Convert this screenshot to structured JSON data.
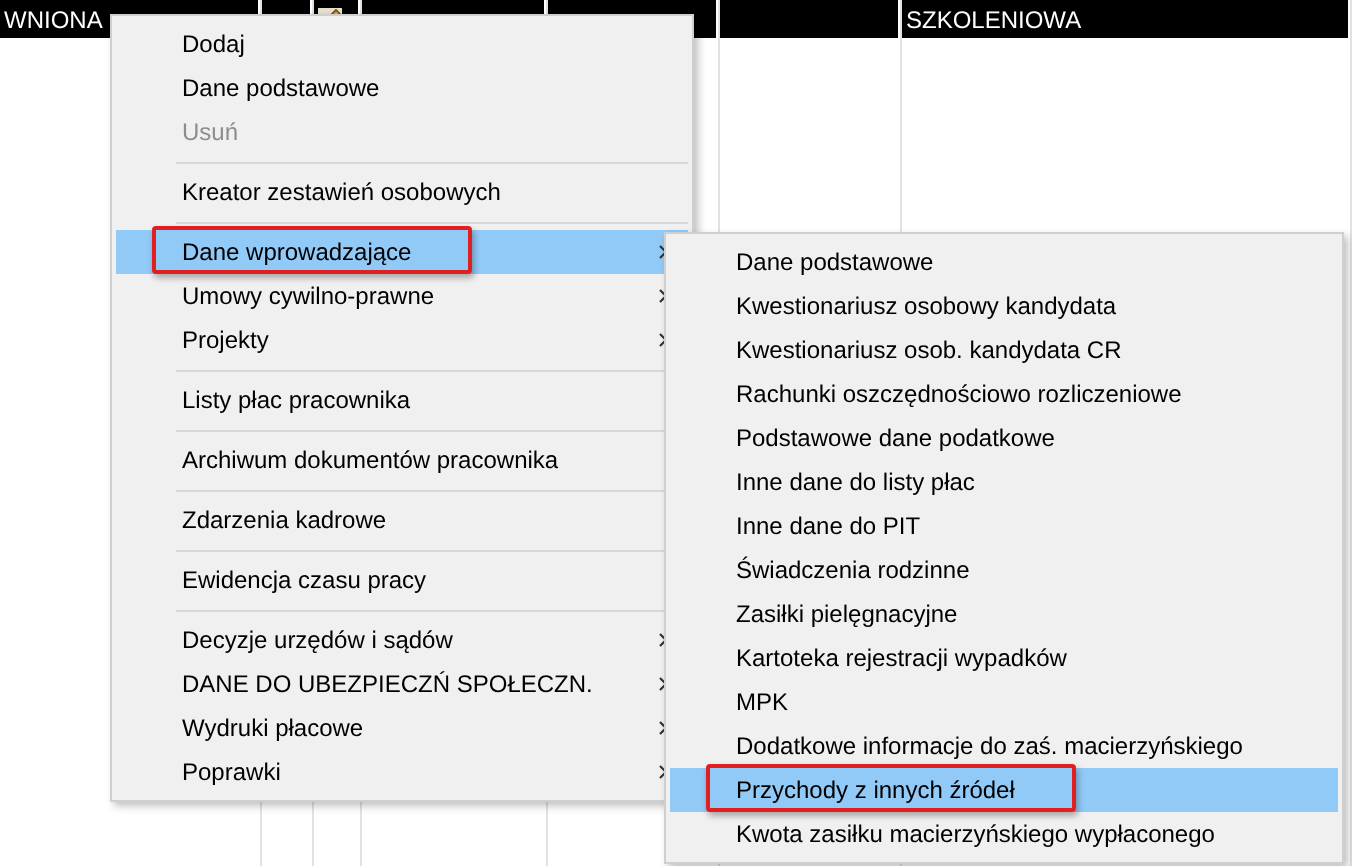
{
  "grid": {
    "columns": [
      {
        "kind": "text",
        "header": "WNIONA"
      },
      {
        "kind": "empty"
      },
      {
        "kind": "icon"
      },
      {
        "kind": "empty"
      },
      {
        "kind": "empty"
      },
      {
        "kind": "empty"
      },
      {
        "kind": "text",
        "header": "SZKOLENIOWA"
      }
    ]
  },
  "context_menu": {
    "items": [
      {
        "kind": "item",
        "label": "Dodaj",
        "disabled": false,
        "selected": false,
        "submenu": false,
        "annotated": false
      },
      {
        "kind": "item",
        "label": "Dane podstawowe",
        "disabled": false,
        "selected": false,
        "submenu": false,
        "annotated": false
      },
      {
        "kind": "item",
        "label": "Usuń",
        "disabled": true,
        "selected": false,
        "submenu": false,
        "annotated": false
      },
      {
        "kind": "separator"
      },
      {
        "kind": "item",
        "label": "Kreator zestawień osobowych",
        "disabled": false,
        "selected": false,
        "submenu": false,
        "annotated": false
      },
      {
        "kind": "separator"
      },
      {
        "kind": "item",
        "label": "Dane wprowadzające",
        "disabled": false,
        "selected": true,
        "submenu": true,
        "annotated": true
      },
      {
        "kind": "item",
        "label": "Umowy cywilno-prawne",
        "disabled": false,
        "selected": false,
        "submenu": true,
        "annotated": false
      },
      {
        "kind": "item",
        "label": "Projekty",
        "disabled": false,
        "selected": false,
        "submenu": true,
        "annotated": false
      },
      {
        "kind": "separator"
      },
      {
        "kind": "item",
        "label": "Listy płac pracownika",
        "disabled": false,
        "selected": false,
        "submenu": false,
        "annotated": false
      },
      {
        "kind": "separator"
      },
      {
        "kind": "item",
        "label": "Archiwum dokumentów pracownika",
        "disabled": false,
        "selected": false,
        "submenu": false,
        "annotated": false
      },
      {
        "kind": "separator"
      },
      {
        "kind": "item",
        "label": "Zdarzenia kadrowe",
        "disabled": false,
        "selected": false,
        "submenu": false,
        "annotated": false
      },
      {
        "kind": "separator"
      },
      {
        "kind": "item",
        "label": "Ewidencja czasu pracy",
        "disabled": false,
        "selected": false,
        "submenu": false,
        "annotated": false
      },
      {
        "kind": "separator"
      },
      {
        "kind": "item",
        "label": "Decyzje urzędów i sądów",
        "disabled": false,
        "selected": false,
        "submenu": true,
        "annotated": false
      },
      {
        "kind": "item",
        "label": "DANE DO UBEZPIECZŃ SPOŁECZN.",
        "disabled": false,
        "selected": false,
        "submenu": true,
        "annotated": false
      },
      {
        "kind": "item",
        "label": "Wydruki płacowe",
        "disabled": false,
        "selected": false,
        "submenu": true,
        "annotated": false
      },
      {
        "kind": "item",
        "label": "Poprawki",
        "disabled": false,
        "selected": false,
        "submenu": true,
        "annotated": false
      }
    ]
  },
  "submenu": {
    "items": [
      {
        "label": "Dane podstawowe",
        "selected": false,
        "annotated": false
      },
      {
        "label": "Kwestionariusz osobowy kandydata",
        "selected": false,
        "annotated": false
      },
      {
        "label": "Kwestionariusz osob. kandydata CR",
        "selected": false,
        "annotated": false
      },
      {
        "label": "Rachunki oszczędnościowo rozliczeniowe",
        "selected": false,
        "annotated": false
      },
      {
        "label": "Podstawowe dane podatkowe",
        "selected": false,
        "annotated": false
      },
      {
        "label": "Inne dane do listy płac",
        "selected": false,
        "annotated": false
      },
      {
        "label": "Inne dane do PIT",
        "selected": false,
        "annotated": false
      },
      {
        "label": "Świadczenia rodzinne",
        "selected": false,
        "annotated": false
      },
      {
        "label": "Zasiłki pielęgnacyjne",
        "selected": false,
        "annotated": false
      },
      {
        "label": "Kartoteka rejestracji wypadków",
        "selected": false,
        "annotated": false
      },
      {
        "label": "MPK",
        "selected": false,
        "annotated": false
      },
      {
        "label": "Dodatkowe informacje do zaś. macierzyńskiego",
        "selected": false,
        "annotated": false
      },
      {
        "label": "Przychody z innych źródeł",
        "selected": true,
        "annotated": true
      },
      {
        "label": "Kwota zasiłku macierzyńskiego wypłaconego",
        "selected": false,
        "annotated": false
      }
    ]
  }
}
